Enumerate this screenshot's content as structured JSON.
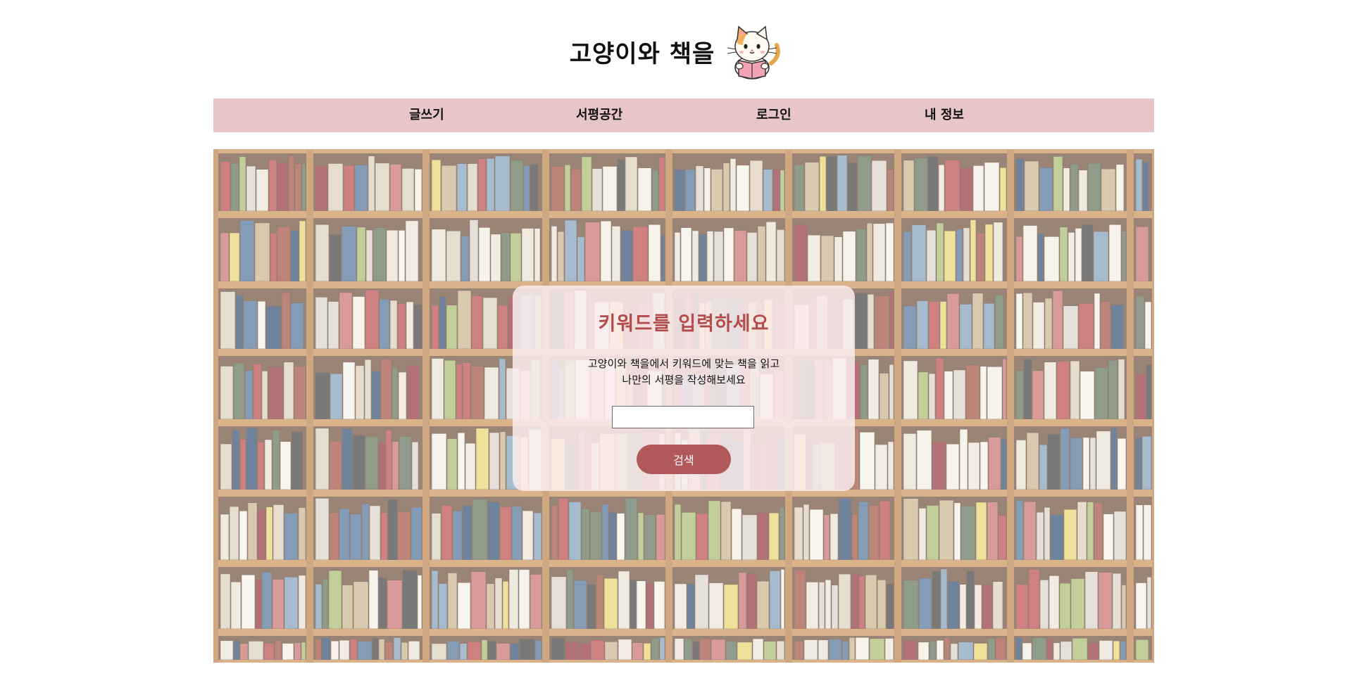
{
  "header": {
    "site_title": "고양이와 책을",
    "logo_icon": "cat-reading-book-icon"
  },
  "nav": {
    "items": [
      {
        "label": "글쓰기"
      },
      {
        "label": "서평공간"
      },
      {
        "label": "로그인"
      },
      {
        "label": "내 정보"
      }
    ],
    "background_color": "#e8c6c8"
  },
  "hero": {
    "background_image": "bookshelf-photo",
    "card": {
      "title": "키워드를 입력하세요",
      "description_line1": "고양이와 책을에서 키워드에 맞는 책을 읽고",
      "description_line2": "나만의 서평을 작성해보세요",
      "search_input_value": "",
      "search_button_label": "검색"
    },
    "accent_color": "#b0585a",
    "title_color": "#b24c4c"
  }
}
